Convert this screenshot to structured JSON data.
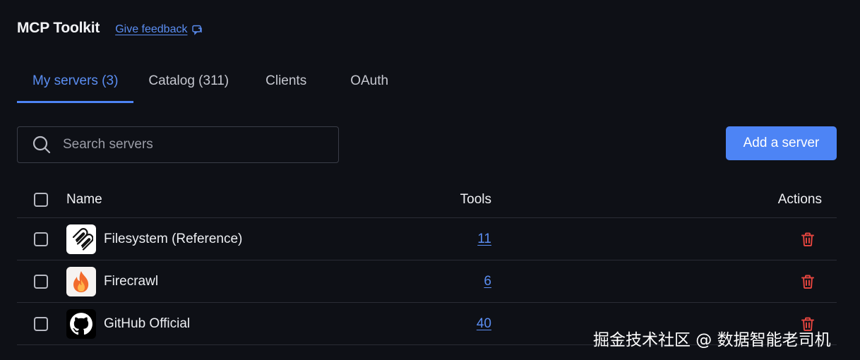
{
  "header": {
    "title": "MCP Toolkit",
    "feedback_label": "Give feedback",
    "feedback_icon": "chat-bubble-icon"
  },
  "tabs": [
    {
      "label": "My servers (3)",
      "active": true
    },
    {
      "label": "Catalog (311)",
      "active": false
    },
    {
      "label": "Clients",
      "active": false
    },
    {
      "label": "OAuth",
      "active": false
    }
  ],
  "search": {
    "placeholder": "Search servers",
    "value": "",
    "icon": "search-icon"
  },
  "add_server_label": "Add a server",
  "table": {
    "columns": [
      "Name",
      "Tools",
      "Actions"
    ],
    "rows": [
      {
        "name": "Filesystem (Reference)",
        "tools": "11",
        "logo": "paperclip-icon",
        "action_icon": "trash-icon"
      },
      {
        "name": "Firecrawl",
        "tools": "6",
        "logo": "flame-icon",
        "action_icon": "trash-icon"
      },
      {
        "name": "GitHub Official",
        "tools": "40",
        "logo": "github-icon",
        "action_icon": "trash-icon"
      }
    ]
  },
  "colors": {
    "background": "#0e1016",
    "accent": "#4d84f5",
    "link": "#5b8ef2",
    "danger": "#e0443e"
  },
  "watermark": "掘金技术社区 @ 数据智能老司机"
}
